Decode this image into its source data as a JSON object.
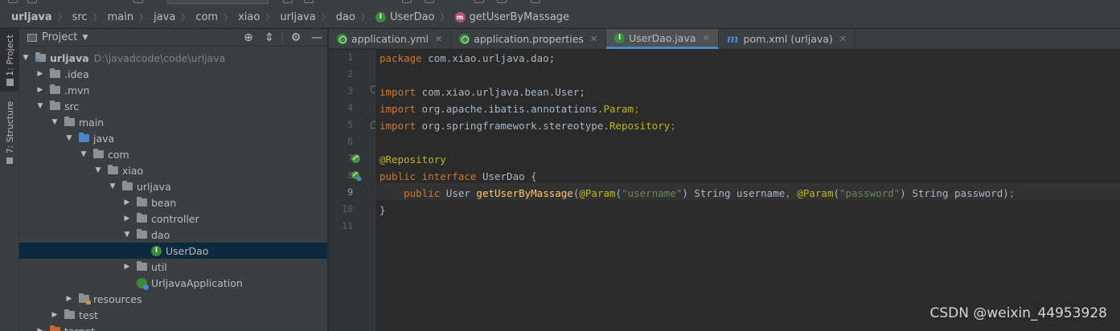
{
  "breadcrumb": {
    "items": [
      "urljava",
      "src",
      "main",
      "java",
      "com",
      "xiao",
      "urljava",
      "dao",
      "UserDao",
      "getUserByMassage"
    ]
  },
  "toolstrip": {
    "project_tab": "1: Project",
    "structure_tab": "7: Structure"
  },
  "project_panel": {
    "title": "Project",
    "tree": [
      {
        "label": "urljava",
        "path": "D:\\javadcode\\code\\urljava"
      },
      {
        "label": ".idea"
      },
      {
        "label": ".mvn"
      },
      {
        "label": "src"
      },
      {
        "label": "main"
      },
      {
        "label": "java"
      },
      {
        "label": "com"
      },
      {
        "label": "xiao"
      },
      {
        "label": "urljava"
      },
      {
        "label": "bean"
      },
      {
        "label": "controller"
      },
      {
        "label": "dao"
      },
      {
        "label": "UserDao"
      },
      {
        "label": "util"
      },
      {
        "label": "UrljavaApplication"
      },
      {
        "label": "resources"
      },
      {
        "label": "test"
      },
      {
        "label": "target"
      }
    ]
  },
  "tabs": [
    {
      "label": "application.yml",
      "active": false
    },
    {
      "label": "application.properties",
      "active": false
    },
    {
      "label": "UserDao.java",
      "active": true
    },
    {
      "label": "pom.xml (urljava)",
      "active": false
    }
  ],
  "editor": {
    "line_numbers": [
      "1",
      "2",
      "3",
      "4",
      "5",
      "6",
      "7",
      "8",
      "9",
      "10",
      "11"
    ],
    "current_line": 9,
    "lines": {
      "l1_kw": "package",
      "l1_rest": " com.xiao.urljava.dao;",
      "l3_kw": "import",
      "l3_rest": " com.xiao.urljava.bean.User;",
      "l4_kw": "import",
      "l4_rest": " org.apache.ibatis.annotations.",
      "l4_cls": "Param",
      "l4_end": ";",
      "l5_kw": "import",
      "l5_rest": " org.springframework.stereotype.",
      "l5_cls": "Repository",
      "l5_end": ";",
      "l7_ann": "@Repository",
      "l8_kw": "public interface",
      "l8_rest": " UserDao {",
      "l9_indent": "    ",
      "l9_kw": "public",
      "l9_type": " User ",
      "l9_fn": "getUserByMassage",
      "l9_p1": "(",
      "l9_ann1": "@Param",
      "l9_p2": "(",
      "l9_str1": "\"username\"",
      "l9_p3": ") String username",
      "l9_comma": ",",
      "l9_sp": " ",
      "l9_ann2": "@Param",
      "l9_p4": "(",
      "l9_str2": "\"password\"",
      "l9_p5": ") String password)",
      "l9_semi": ";",
      "l10": "}"
    }
  },
  "watermark": "CSDN @weixin_44953928",
  "colors": {
    "keyword": "#cc7832",
    "annotation": "#bbb529",
    "string": "#6a8759",
    "function": "#ffc66d",
    "selection": "#0d293e",
    "accent": "#4a88c7"
  }
}
